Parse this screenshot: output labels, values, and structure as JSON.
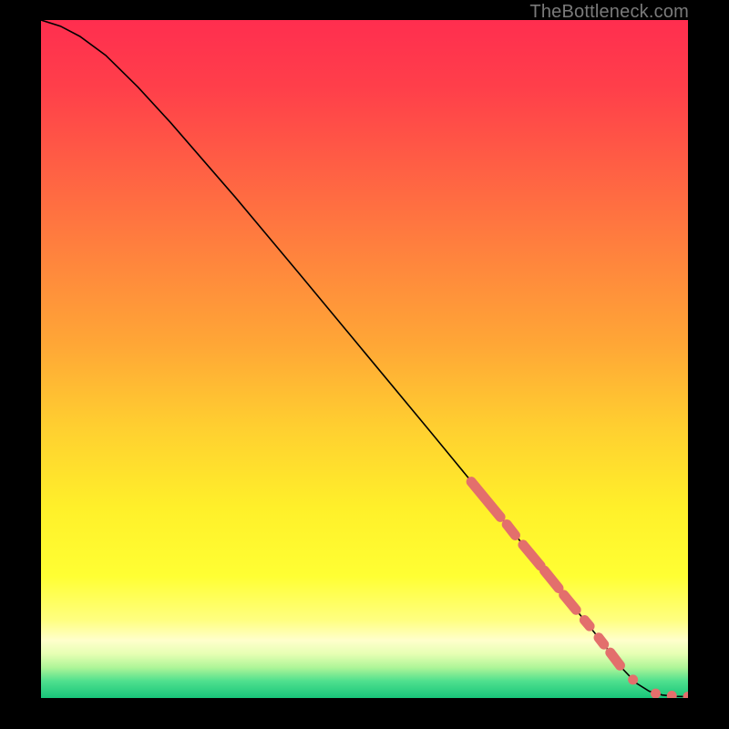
{
  "attribution": "TheBottleneck.com",
  "chart_data": {
    "type": "line",
    "title": "",
    "xlabel": "",
    "ylabel": "",
    "xlim": [
      0,
      100
    ],
    "ylim": [
      0,
      100
    ],
    "curve": {
      "x": [
        0,
        3,
        6,
        10,
        15,
        20,
        30,
        40,
        50,
        60,
        70,
        80,
        86,
        90,
        92,
        94,
        96,
        98,
        100
      ],
      "y": [
        100,
        99.1,
        97.6,
        94.8,
        90.1,
        84.9,
        73.9,
        62.5,
        51.0,
        39.5,
        27.9,
        16.2,
        9.1,
        4.2,
        2.2,
        1.0,
        0.45,
        0.25,
        0.2
      ]
    },
    "marker_segments": [
      {
        "x0": 66.5,
        "y0": 31.9,
        "x1": 71.0,
        "y1": 26.7
      },
      {
        "x0": 72.0,
        "y0": 25.6,
        "x1": 73.3,
        "y1": 24.0
      },
      {
        "x0": 74.5,
        "y0": 22.6,
        "x1": 77.2,
        "y1": 19.5
      },
      {
        "x0": 77.8,
        "y0": 18.8,
        "x1": 80.0,
        "y1": 16.2
      },
      {
        "x0": 80.8,
        "y0": 15.2,
        "x1": 82.7,
        "y1": 13.0
      },
      {
        "x0": 84.0,
        "y0": 11.5,
        "x1": 84.8,
        "y1": 10.6
      },
      {
        "x0": 86.2,
        "y0": 8.9,
        "x1": 87.0,
        "y1": 7.9
      },
      {
        "x0": 88.0,
        "y0": 6.7,
        "x1": 89.5,
        "y1": 4.8
      }
    ],
    "marker_points": [
      {
        "x": 91.5,
        "y": 2.7
      },
      {
        "x": 95.0,
        "y": 0.65
      },
      {
        "x": 97.5,
        "y": 0.33
      },
      {
        "x": 100.0,
        "y": 0.21
      }
    ],
    "marker_color": "#e36f6c",
    "line_color": "#000000",
    "gradient_stops": [
      {
        "offset": 0.0,
        "color": "#ff2e4f"
      },
      {
        "offset": 0.1,
        "color": "#ff3f4a"
      },
      {
        "offset": 0.22,
        "color": "#ff6044"
      },
      {
        "offset": 0.35,
        "color": "#ff843d"
      },
      {
        "offset": 0.48,
        "color": "#ffa736"
      },
      {
        "offset": 0.6,
        "color": "#ffcf30"
      },
      {
        "offset": 0.72,
        "color": "#fff02a"
      },
      {
        "offset": 0.82,
        "color": "#ffff33"
      },
      {
        "offset": 0.885,
        "color": "#ffff80"
      },
      {
        "offset": 0.915,
        "color": "#ffffcc"
      },
      {
        "offset": 0.935,
        "color": "#e6ffb3"
      },
      {
        "offset": 0.955,
        "color": "#aef598"
      },
      {
        "offset": 0.975,
        "color": "#4fe08e"
      },
      {
        "offset": 1.0,
        "color": "#18c57a"
      }
    ]
  }
}
